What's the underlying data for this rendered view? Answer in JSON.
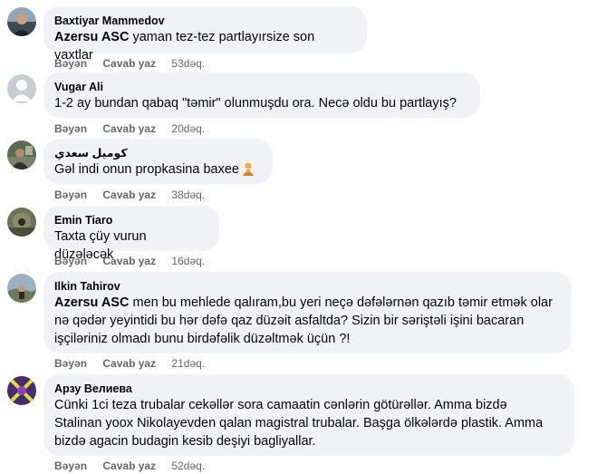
{
  "comments": [
    {
      "author": "Baxtiyar Mammedov",
      "mention": "Azersu ASC",
      "text": " yaman tez-tez partlayırsize son vaxtlar",
      "like_label": "Bəyən",
      "reply_label": "Cavab yaz",
      "time": "53dəq."
    },
    {
      "author": "Vugar Ali",
      "mention": "",
      "text": "1-2 ay bundan qabaq \"təmir\" olunmuşdu ora. Necə oldu bu partlayış?",
      "like_label": "Bəyən",
      "reply_label": "Cavab yaz",
      "time": "20dəq."
    },
    {
      "author": "كوميل سعدي",
      "mention": "",
      "text": "Gəl indi onun propkasina baxee",
      "emoji": "person-thinking-emoji",
      "like_label": "Bəyən",
      "reply_label": "Cavab yaz",
      "time": "38dəq."
    },
    {
      "author": "Emin Tiaro",
      "mention": "",
      "text": "Taxta çüy vurun düzələcək",
      "like_label": "Bəyən",
      "reply_label": "Cavab yaz",
      "time": "16dəq."
    },
    {
      "author": "Ilkin Tahirov",
      "mention": "Azersu ASC",
      "text": " men bu mehlede qalıram,bu yeri neçə dəfələrnən qazıb təmir etmək olar\nnə qədər yeyintidi bu hər dəfə qaz düzəit asfaltda? Sizin bir səriştəli işini bacaran\nişçiləriniz olmadı bunu birdəfəlik düzəltmək üçün ?!",
      "like_label": "Bəyən",
      "reply_label": "Cavab yaz",
      "time": "21dəq."
    },
    {
      "author": "Арзу Велиева",
      "mention": "",
      "text": "Cünki 1ci teza trubalar cekəllər sora camaatin cənlərin götürəllər. Amma bizdə\nStalinan yoox Nikolayevden qalan magistral trubalar. Başga ölkələrdə plastik. Amma\nbizdə agacin budagin kesib deşiyi bagliyallar.",
      "like_label": "Bəyən",
      "reply_label": "Cavab yaz",
      "time": "52dəq."
    }
  ],
  "colors": {
    "bubble": "#f0f2f5",
    "text": "#050505",
    "meta": "#65676b"
  }
}
